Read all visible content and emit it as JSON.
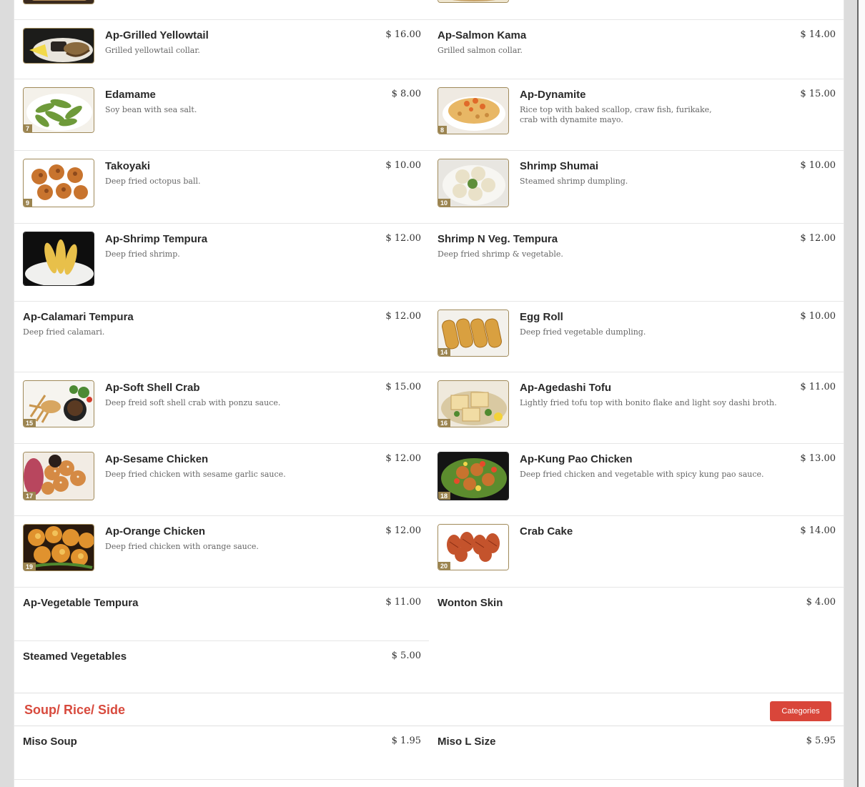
{
  "items": [
    {
      "name": "Ap-Grilled Yellowtail",
      "price": "$ 16.00",
      "desc": "Grilled yellowtail collar.",
      "num": ""
    },
    {
      "name": "Ap-Salmon Kama",
      "price": "$ 14.00",
      "desc": "Grilled salmon collar.",
      "num": ""
    },
    {
      "name": "Edamame",
      "price": "$ 8.00",
      "desc": "Soy bean with sea salt.",
      "num": "7"
    },
    {
      "name": "Ap-Dynamite",
      "price": "$ 15.00",
      "desc": "Rice top with baked scallop, craw fish, furikake, crab with dynamite mayo.",
      "num": "8"
    },
    {
      "name": "Takoyaki",
      "price": "$ 10.00",
      "desc": "Deep fried octopus ball.",
      "num": "9"
    },
    {
      "name": "Shrimp Shumai",
      "price": "$ 10.00",
      "desc": "Steamed shrimp dumpling.",
      "num": "10"
    },
    {
      "name": "Ap-Shrimp Tempura",
      "price": "$ 12.00",
      "desc": "Deep fried shrimp.",
      "num": ""
    },
    {
      "name": "Shrimp N Veg. Tempura",
      "price": "$ 12.00",
      "desc": "Deep fried shrimp & vegetable.",
      "num": ""
    },
    {
      "name": "Ap-Calamari Tempura",
      "price": "$ 12.00",
      "desc": "Deep fried calamari.",
      "num": ""
    },
    {
      "name": "Egg Roll",
      "price": "$ 10.00",
      "desc": "Deep fried vegetable dumpling.",
      "num": "14"
    },
    {
      "name": "Ap-Soft Shell Crab",
      "price": "$ 15.00",
      "desc": "Deep freid soft shell crab with ponzu sauce.",
      "num": "15"
    },
    {
      "name": "Ap-Agedashi Tofu",
      "price": "$ 11.00",
      "desc": "Lightly fried tofu top with bonito flake and light soy dashi broth.",
      "num": "16"
    },
    {
      "name": "Ap-Sesame Chicken",
      "price": "$ 12.00",
      "desc": "Deep fried chicken with sesame garlic sauce.",
      "num": "17"
    },
    {
      "name": "Ap-Kung Pao Chicken",
      "price": "$ 13.00",
      "desc": "Deep fried chicken and vegetable with spicy kung pao sauce.",
      "num": "18"
    },
    {
      "name": "Ap-Orange Chicken",
      "price": "$ 12.00",
      "desc": "Deep fried chicken with orange sauce.",
      "num": "19"
    },
    {
      "name": "Crab Cake",
      "price": "$ 14.00",
      "desc": "",
      "num": "20"
    },
    {
      "name": "Ap-Vegetable Tempura",
      "price": "$ 11.00",
      "desc": "",
      "num": ""
    },
    {
      "name": "Wonton Skin",
      "price": "$ 4.00",
      "desc": "",
      "num": ""
    },
    {
      "name": "Steamed Vegetables",
      "price": "$ 5.00",
      "desc": "",
      "num": ""
    },
    {
      "name": "Miso Soup",
      "price": "$ 1.95",
      "desc": "",
      "num": ""
    },
    {
      "name": "Miso L Size",
      "price": "$ 5.95",
      "desc": "",
      "num": ""
    }
  ],
  "category": {
    "title": "Soup/ Rice/ Side",
    "button": "Categories"
  },
  "colors": {
    "accent": "#d9463a",
    "badge": "#9b8450"
  }
}
